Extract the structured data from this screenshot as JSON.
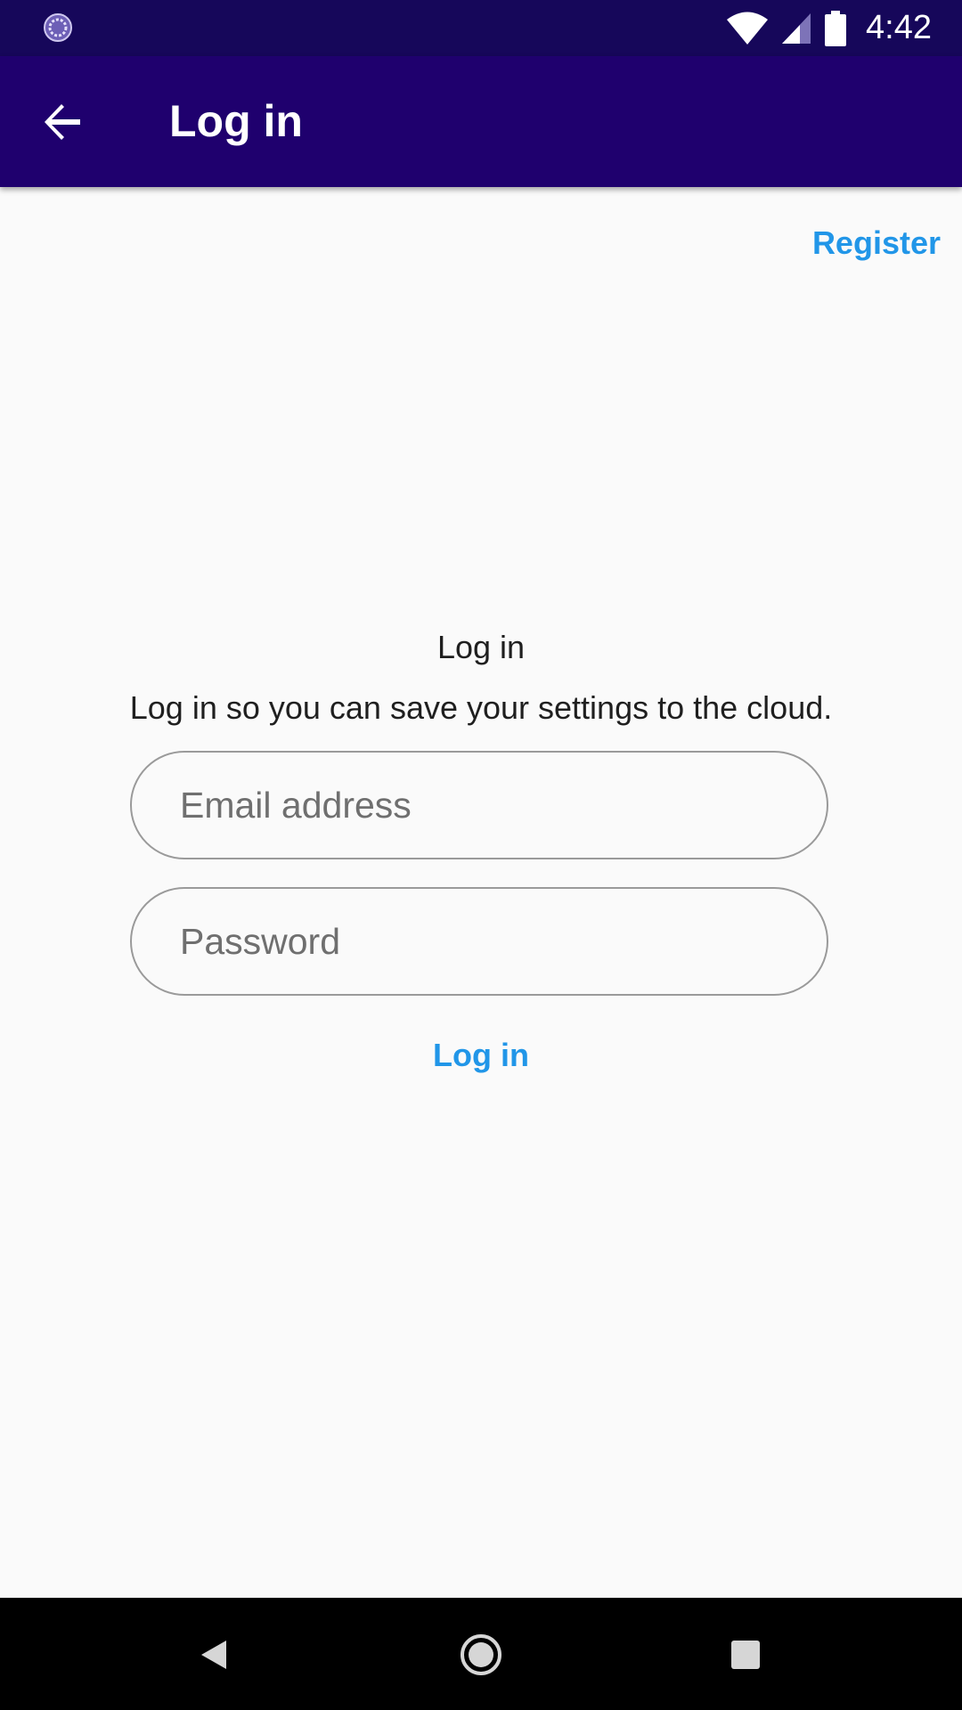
{
  "status_bar": {
    "time": "4:42",
    "icons": [
      "sync-circle-icon",
      "wifi-icon",
      "cellular-signal-icon",
      "battery-icon"
    ]
  },
  "app_bar": {
    "title": "Log in",
    "back_icon": "arrow-back-icon",
    "background": "#1f006e"
  },
  "register": {
    "label": "Register"
  },
  "form": {
    "title": "Log in",
    "subtitle": "Log in so you can save your settings to the cloud.",
    "email": {
      "value": "",
      "placeholder": "Email address"
    },
    "password": {
      "value": "",
      "placeholder": "Password"
    },
    "submit_label": "Log in"
  },
  "colors": {
    "accent": "#2196e8",
    "status_bar": "#16075a",
    "background": "#fafafa"
  },
  "nav_bar": {
    "icons": [
      "nav-back-icon",
      "nav-home-icon",
      "nav-recents-icon"
    ]
  }
}
